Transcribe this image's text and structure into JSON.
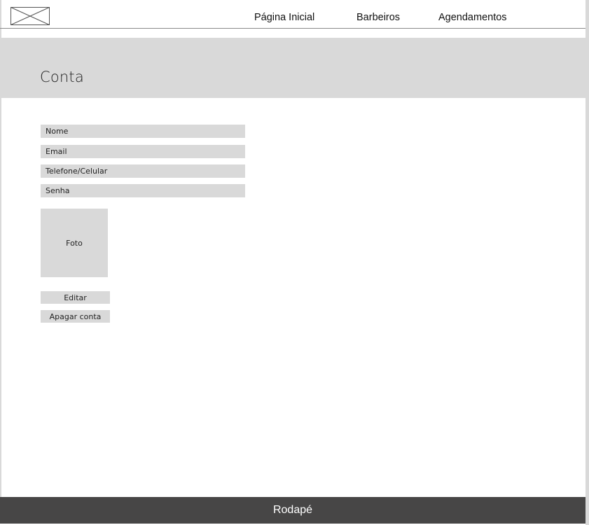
{
  "header": {
    "logo_icon": "image-placeholder-icon",
    "nav": {
      "home": "Página Inicial",
      "barbers": "Barbeiros",
      "bookings": "Agendamentos"
    }
  },
  "banner": {
    "title": "Conta"
  },
  "form": {
    "name_placeholder": "Nome",
    "email_placeholder": "Email",
    "phone_placeholder": "Telefone/Celular",
    "password_placeholder": "Senha",
    "photo_label": "Foto"
  },
  "actions": {
    "edit_label": "Editar",
    "delete_label": "Apagar conta"
  },
  "footer": {
    "label": "Rodapé"
  },
  "colors": {
    "placeholder_gray": "#d9d9d9",
    "footer_bg": "#474646",
    "footer_text": "#ffffff"
  }
}
